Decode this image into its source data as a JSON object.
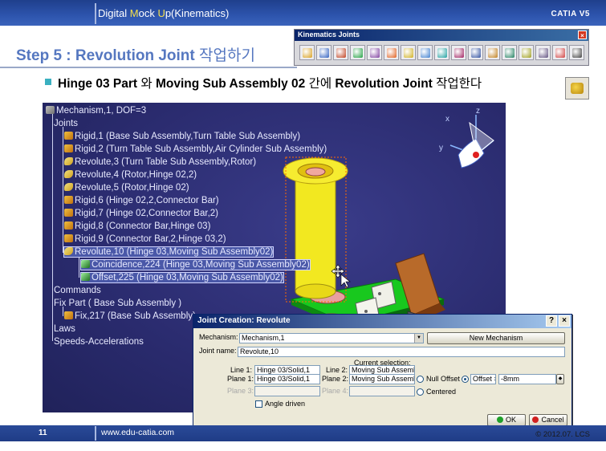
{
  "header": {
    "title_prefix": "Digital ",
    "title_m": "M",
    "title_mid": "ock ",
    "title_u": "U",
    "title_suffix": "p(Kinematics)",
    "brand": "CATIA V5"
  },
  "step": {
    "title": "Step 5 : Revolution Joint ",
    "title_ko": "작업하기"
  },
  "toolbar": {
    "title": "Kinematics Joints",
    "close": "×",
    "icons": [
      "revolute-joint-icon",
      "prismatic-joint-icon",
      "cylindrical-joint-icon",
      "screw-joint-icon",
      "spherical-joint-icon",
      "planar-joint-icon",
      "rigid-joint-icon",
      "point-curve-joint-icon",
      "slide-curve-joint-icon",
      "roll-curve-joint-icon",
      "point-surface-joint-icon",
      "universal-joint-icon",
      "cv-joint-icon",
      "gear-joint-icon",
      "rack-joint-icon",
      "cable-joint-icon",
      "axis-system-joint-icon"
    ]
  },
  "instruction": {
    "part1": "Hinge 03 Part ",
    "part1_ko": "와 ",
    "part2": " Moving Sub Assembly 02 ",
    "part2_ko": "간에 ",
    "part3": "Revolution Joint ",
    "part3_ko": "작업한다"
  },
  "tree": {
    "root": "Mechanism,1, DOF=3",
    "joints": "Joints",
    "items": [
      "Rigid,1 (Base Sub Assembly,Turn Table Sub Assembly)",
      "Rigid,2 (Turn Table Sub Assembly,Air Cylinder Sub Assembly)",
      "Revolute,3 (Turn Table Sub Assembly,Rotor)",
      "Revolute,4 (Rotor,Hinge 02,2)",
      "Revolute,5 (Rotor,Hinge 02)",
      "Rigid,6 (Hinge 02,2,Connector Bar)",
      "Rigid,7 (Hinge 02,Connector Bar,2)",
      "Rigid,8 (Connector Bar,Hinge 03)",
      "Rigid,9 (Connector Bar,2,Hinge 03,2)",
      "Revolute,10 (Hinge 03,Moving Sub Assembly02)"
    ],
    "constraints": [
      "Coincidence,224 (Hinge 03,Moving Sub Assembly02)",
      "Offset,225 (Hinge 03,Moving Sub Assembly02)"
    ],
    "commands": "Commands",
    "fix_part": "Fix Part ( Base Sub Assembly )",
    "fix": "Fix,217 (Base Sub Assembly)",
    "laws": "Laws",
    "speeds": "Speeds-Accelerations"
  },
  "axes": {
    "z": "z",
    "x": "x",
    "y": "y"
  },
  "dialog": {
    "title": "Joint Creation: Revolute",
    "help": "?",
    "close": "×",
    "mechanism_label": "Mechanism:",
    "mechanism_value": "Mechanism,1",
    "new_mechanism": "New Mechanism",
    "joint_name_label": "Joint name:",
    "joint_name_value": "Revolute,10",
    "current_selection": "Current selection:",
    "line1_label": "Line 1:",
    "line1_value": "Hinge 03/Solid,1",
    "line2_label": "Line 2:",
    "line2_value": "Moving Sub Assemb",
    "plane1_label": "Plane 1:",
    "plane1_value": "Hinge 03/Solid,1",
    "plane2_label": "Plane 2:",
    "plane2_value": "Moving Sub Assemb",
    "null_offset": "Null Offset",
    "offset_label": "Offset =",
    "offset_value": "-8mm",
    "plane3_label": "Plane 3:",
    "plane3_value": "",
    "plane4_label": "Plane 4:",
    "plane4_value": "",
    "centered": "Centered",
    "angle_driven": "Angle driven",
    "ok": "OK",
    "cancel": "Cancel"
  },
  "footer": {
    "page": "11",
    "url": "www.edu-catia.com",
    "copyright": "© 2012.07. LCS"
  }
}
